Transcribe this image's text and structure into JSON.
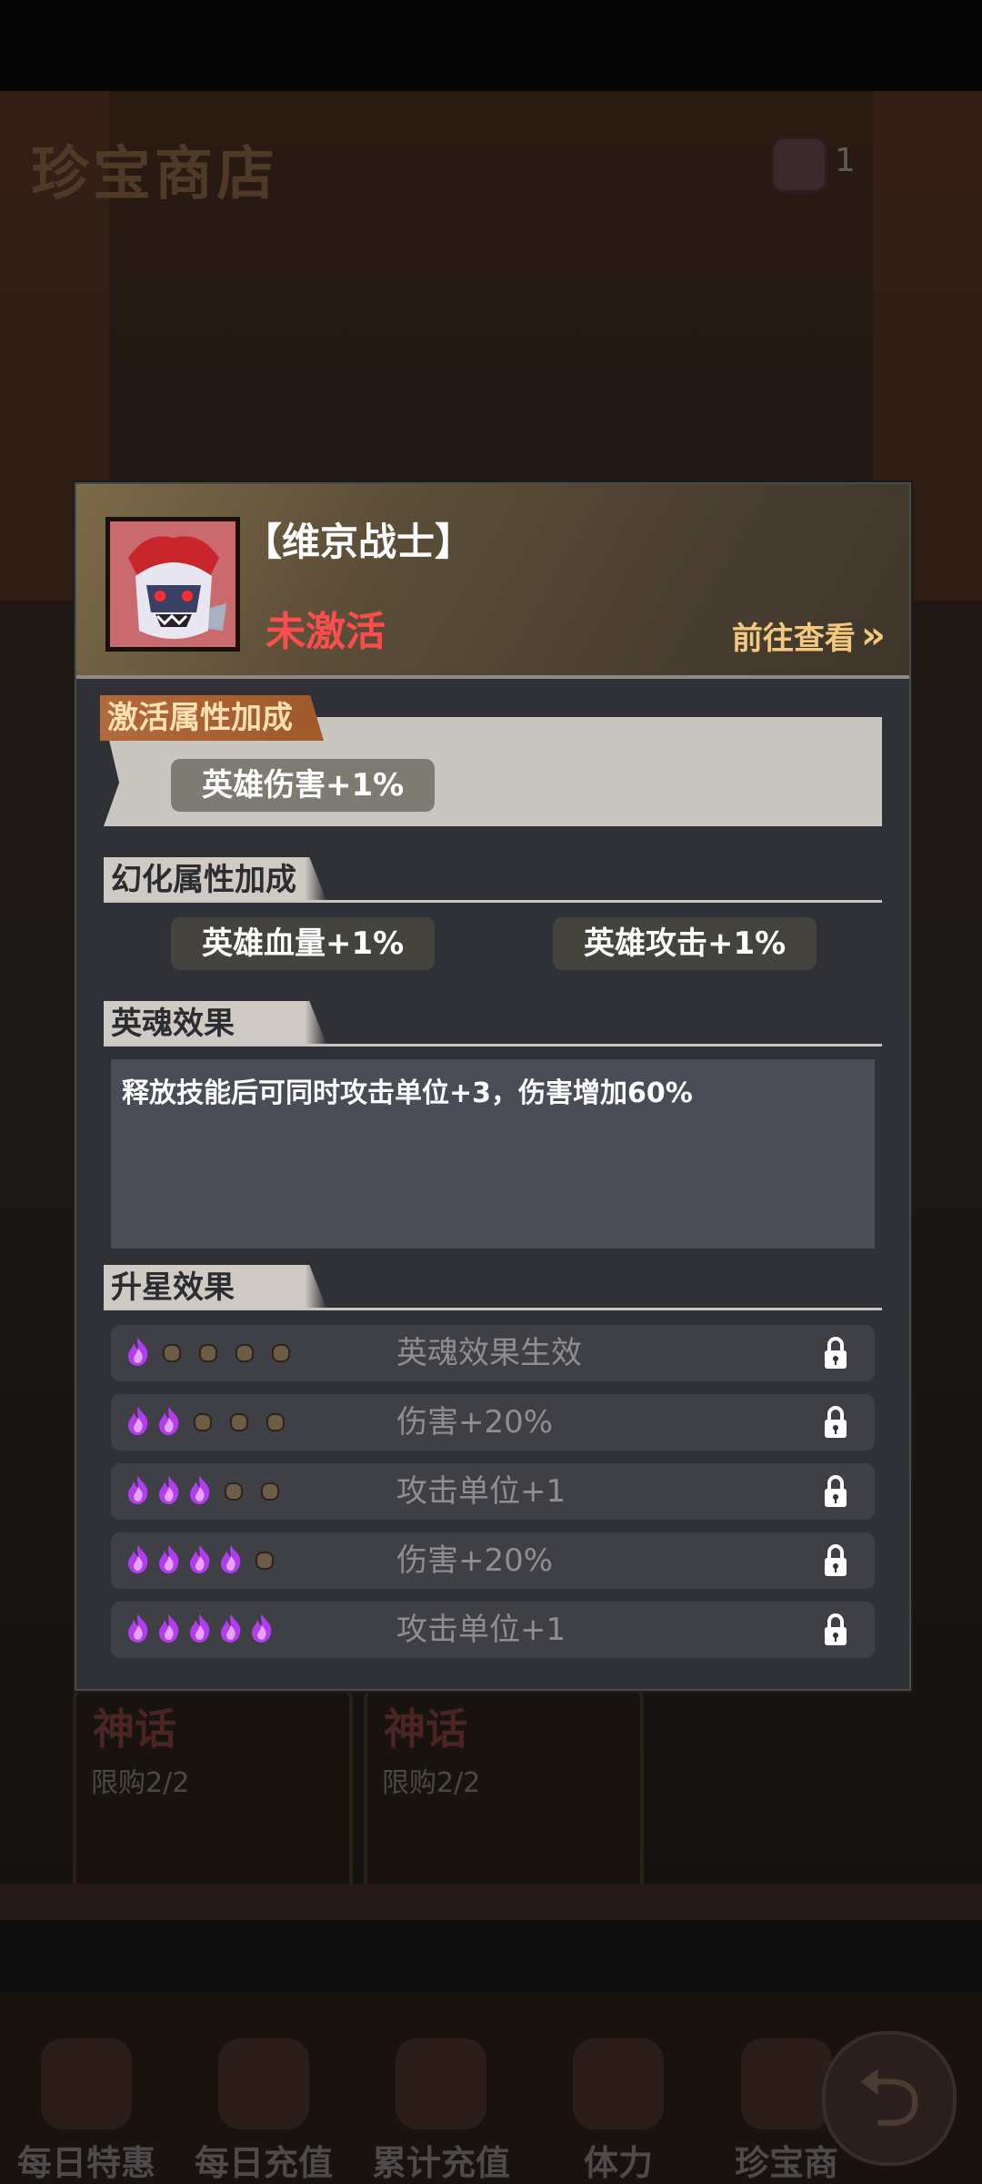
{
  "background": {
    "shop_title": "珍宝商店",
    "gem_count": "1",
    "cards": [
      {
        "title": "神话",
        "limit": "限购2/2"
      },
      {
        "title": "神话",
        "limit": "限购2/2"
      }
    ],
    "nav": [
      {
        "label": "每日特惠",
        "icon": "gift-box-icon"
      },
      {
        "label": "每日充值",
        "icon": "money-bag-icon"
      },
      {
        "label": "累计充值",
        "icon": "treasure-bag-icon"
      },
      {
        "label": "体力",
        "icon": "lightning-icon"
      },
      {
        "label": "珍宝商",
        "icon": "shop-icon"
      }
    ]
  },
  "dialog": {
    "hero_name": "【维京战士】",
    "status": "未激活",
    "goto_label": "前往查看",
    "colors": {
      "status": "#ff4d4d",
      "goto": "#f3c97f"
    },
    "activate_section": {
      "title": "激活属性加成",
      "bonuses": [
        "英雄伤害+1%"
      ]
    },
    "transform_section": {
      "title": "幻化属性加成",
      "bonuses": [
        "英雄血量+1%",
        "英雄攻击+1%"
      ]
    },
    "soul_section": {
      "title": "英魂效果",
      "text": "释放技能后可同时攻击单位+3，伤害增加60%"
    },
    "star_section": {
      "title": "升星效果",
      "rows": [
        {
          "stars": 1,
          "effect": "英魂效果生效",
          "locked": true
        },
        {
          "stars": 2,
          "effect": "伤害+20%",
          "locked": true
        },
        {
          "stars": 3,
          "effect": "攻击单位+1",
          "locked": true
        },
        {
          "stars": 4,
          "effect": "伤害+20%",
          "locked": true
        },
        {
          "stars": 5,
          "effect": "攻击单位+1",
          "locked": true
        }
      ]
    }
  }
}
